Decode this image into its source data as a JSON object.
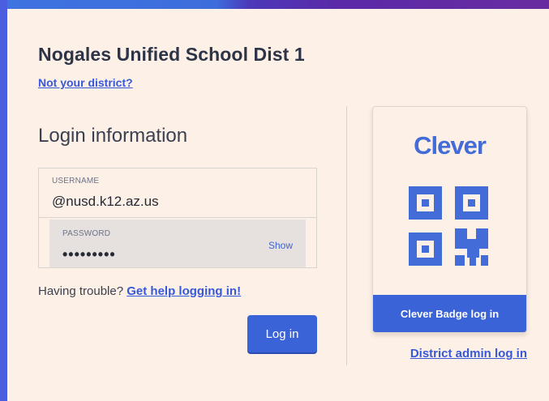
{
  "district": {
    "name": "Nogales Unified School Dist 1",
    "change_link": "Not your district?"
  },
  "login": {
    "heading": "Login information",
    "username_label": "USERNAME",
    "username_value": "@nusd.k12.az.us",
    "password_label": "PASSWORD",
    "password_value": "•••••••••",
    "show_label": "Show",
    "trouble_text": "Having trouble?",
    "help_link": "Get help logging in!",
    "submit_label": "Log in"
  },
  "badge": {
    "logo_text": "Clever",
    "qr_icon": "qr-code-icon",
    "button_label": "Clever Badge log in"
  },
  "admin": {
    "link_label": "District admin log in"
  },
  "colors": {
    "accent": "#3b63d8",
    "background": "#fdf0e6",
    "text": "#2d3447"
  }
}
